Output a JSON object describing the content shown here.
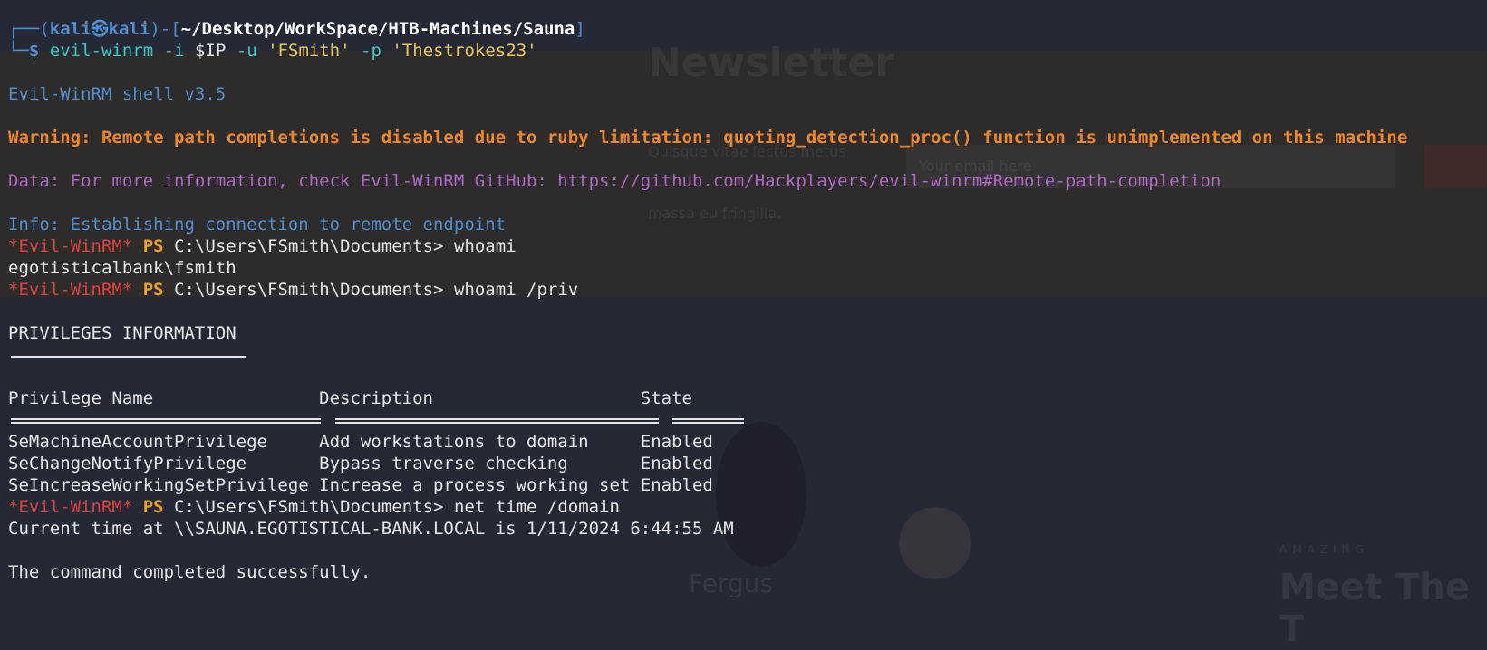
{
  "prompt": {
    "corner_top": "┌──(",
    "user": "kali",
    "skull": "㉿",
    "host": "kali",
    "mid": ")-[",
    "path": "~/Desktop/WorkSpace/HTB-Machines/Sauna",
    "end": "]",
    "corner_bottom": "└─",
    "dollar": "$"
  },
  "command": {
    "program": "evil-winrm",
    "flag_i": "-i",
    "ip": "$IP",
    "flag_u": "-u",
    "user": "'FSmith'",
    "flag_p": "-p",
    "password": "'Thestrokes23'"
  },
  "output": {
    "shell_version": "Evil-WinRM shell v3.5",
    "warning": "Warning: Remote path completions is disabled due to ruby limitation: quoting_detection_proc() function is unimplemented on this machine",
    "data": "Data: For more information, check Evil-WinRM GitHub: https://github.com/Hackplayers/evil-winrm#Remote-path-completion",
    "info": "Info: Establishing connection to remote endpoint",
    "ps_prefix": "*Evil-WinRM*",
    "ps_label": "PS",
    "ps_path": "C:\\Users\\FSmith\\Documents>",
    "cmd_whoami": "whoami",
    "whoami_result": "egotisticalbank\\fsmith",
    "cmd_whoami_priv": "whoami /priv",
    "priv_header": "PRIVILEGES INFORMATION",
    "table_header": "Privilege Name                Description                    State",
    "table_rows": [
      "SeMachineAccountPrivilege     Add workstations to domain     Enabled",
      "SeChangeNotifyPrivilege       Bypass traverse checking       Enabled",
      "SeIncreaseWorkingSetPrivilege Increase a process working set Enabled"
    ],
    "cmd_net_time": "net time /domain",
    "time_result": "Current time at \\\\SAUNA.EGOTISTICAL-BANK.LOCAL is 1/11/2024 6:44:55 AM",
    "completed": "The command completed successfully."
  },
  "background": {
    "title": "Newsletter",
    "text1": "Quisque vitae lectus metus",
    "placeholder": "Your email here",
    "text2": "massa eu fringilla.",
    "name": "Fergus",
    "eyebrow": "AMAZING",
    "heading": "Meet The T"
  },
  "colors": {
    "background": "#252936",
    "prompt_blue": "#4f8fd1",
    "warning_orange": "#f0862a",
    "data_purple": "#b068c8",
    "evilwinrm_red": "#e04040",
    "ps_orange": "#f0a020"
  }
}
